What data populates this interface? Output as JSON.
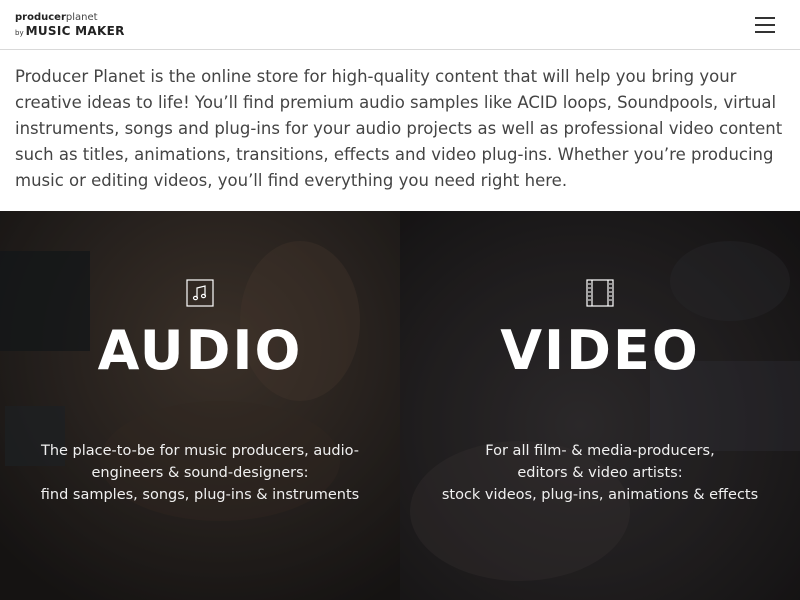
{
  "header": {
    "logo": {
      "line1_bold": "producer",
      "line1_light": "planet",
      "by": "by",
      "brand": "MUSIC MAKER"
    },
    "menu_icon": "hamburger-menu-icon"
  },
  "intro": {
    "text": "Producer Planet is the online store for high-quality content that will help you bring your creative ideas to life! You’ll find premium audio samples like ACID loops, Soundpools, virtual instruments, songs and plug-ins for your audio projects as well as professional video content such as titles, animations, transitions, effects and video plug-ins. Whether you’re producing music or editing videos, you’ll find everything you need right here."
  },
  "panels": {
    "audio": {
      "icon": "music-note-icon",
      "title": "AUDIO",
      "desc_line1": "The place-to-be for music producers, audio-",
      "desc_line2": "engineers & sound-designers:",
      "desc_line3": "find samples, songs, plug-ins & instruments"
    },
    "video": {
      "icon": "film-strip-icon",
      "title": "VIDEO",
      "desc_line1": "For all film- & media-producers,",
      "desc_line2": "editors & video artists:",
      "desc_line3": "stock videos, plug-ins, animations & effects"
    }
  },
  "colors": {
    "header_bg": "#ffffff",
    "intro_text": "#444444",
    "panel_text": "#ffffff",
    "audio_bg": "#2a2624",
    "video_bg": "#232021"
  }
}
